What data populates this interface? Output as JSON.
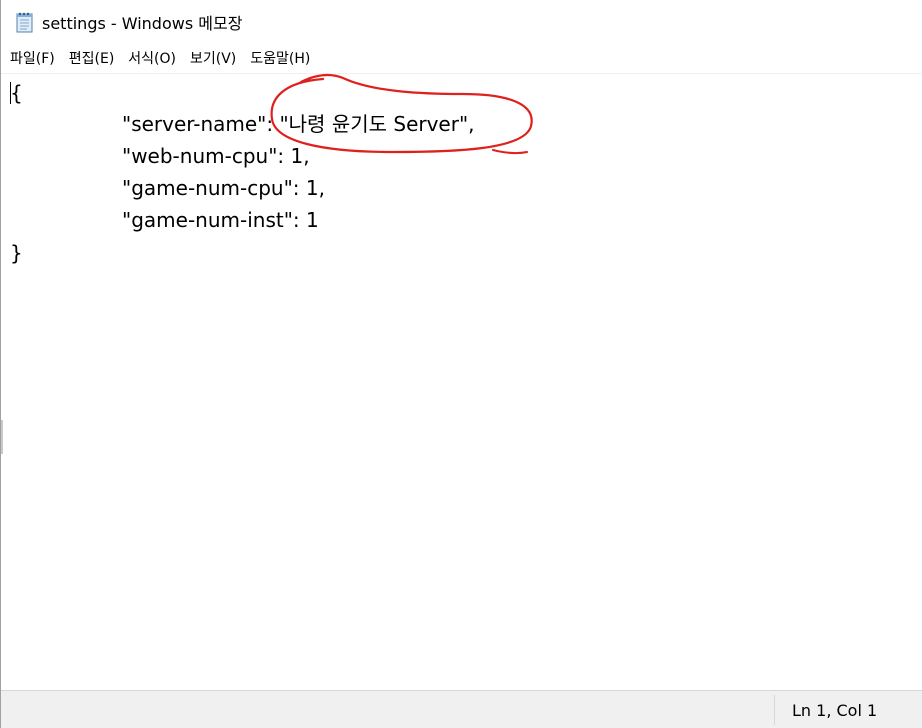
{
  "window": {
    "title": "settings - Windows 메모장",
    "icon": "notepad-icon"
  },
  "menu": {
    "items": [
      {
        "label": "파일(F)"
      },
      {
        "label": "편집(E)"
      },
      {
        "label": "서식(O)"
      },
      {
        "label": "보기(V)"
      },
      {
        "label": "도움말(H)"
      }
    ]
  },
  "editor": {
    "lines": [
      "{",
      "\"server-name\": \"나령 윤기도 Server\",",
      "\"web-num-cpu\": 1,",
      "\"game-num-cpu\": 1,",
      "\"game-num-inst\": 1",
      "}"
    ],
    "annotation_color": "#e0201c"
  },
  "status": {
    "position": "Ln 1, Col 1"
  }
}
